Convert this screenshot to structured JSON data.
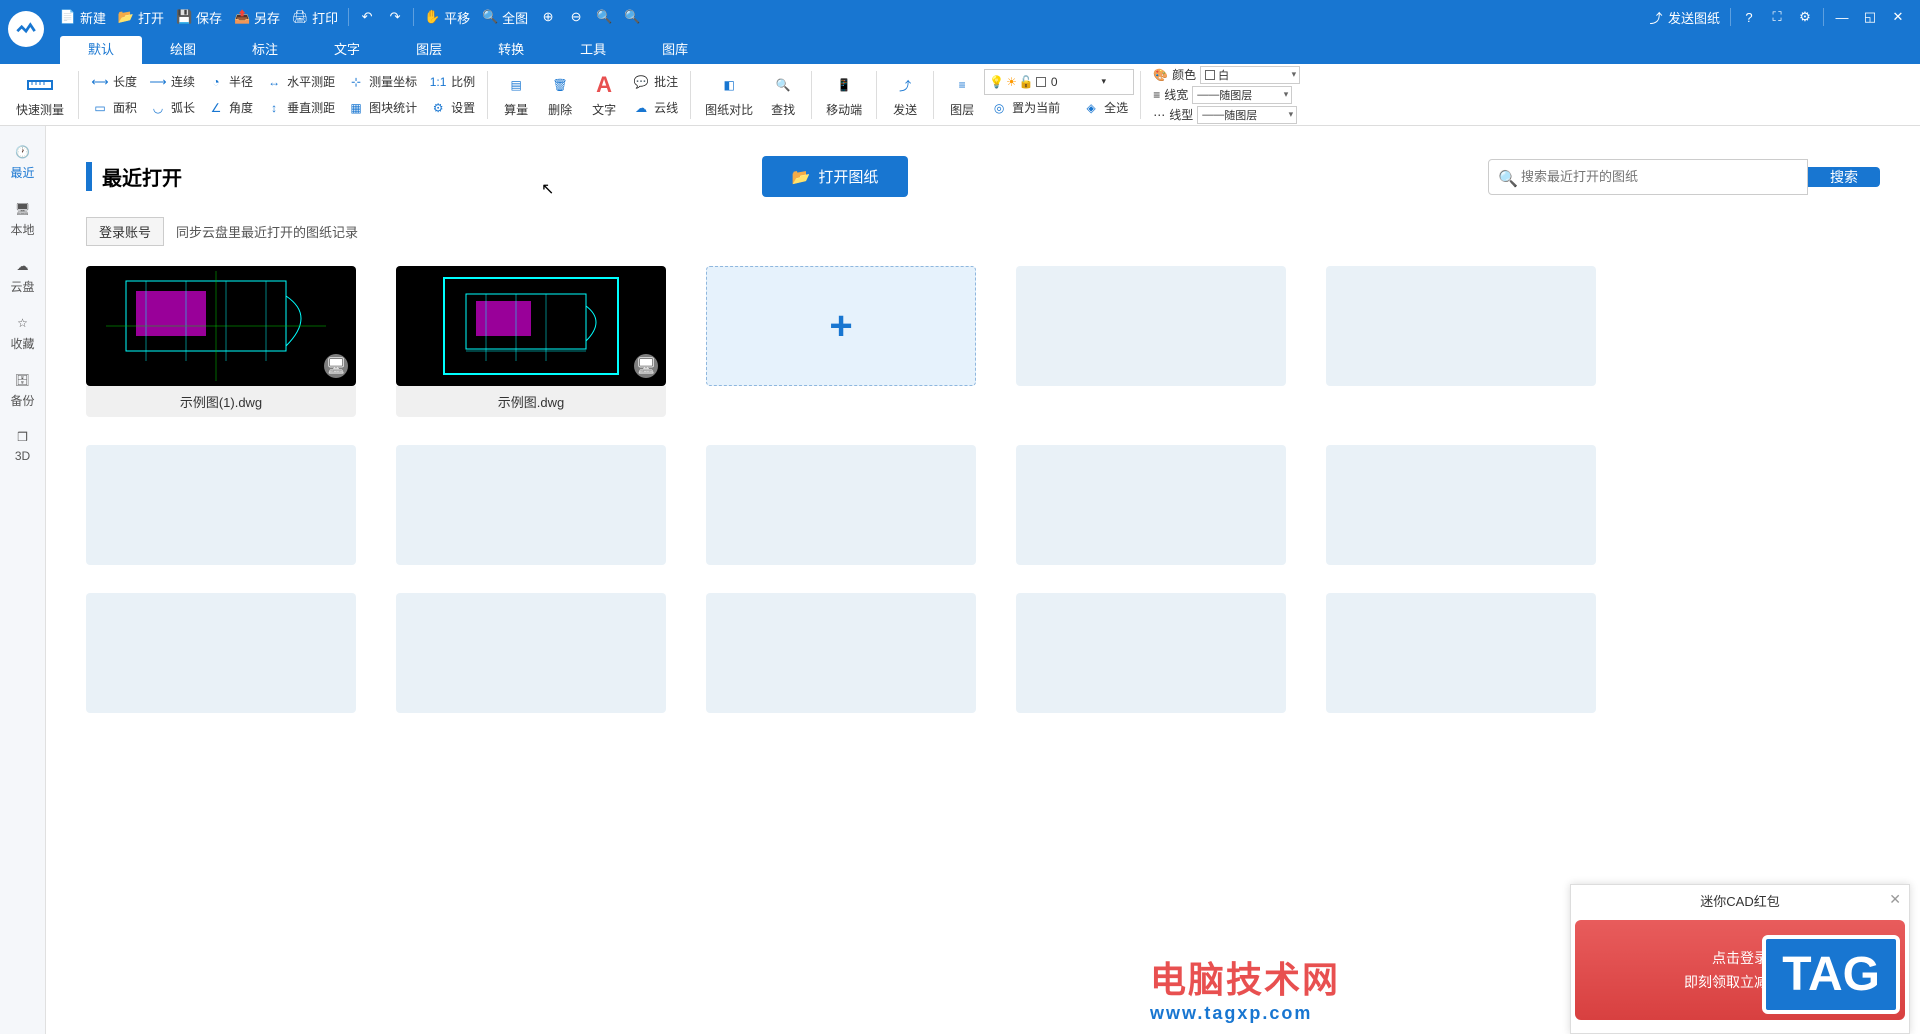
{
  "titlebar": {
    "new": "新建",
    "open": "打开",
    "save": "保存",
    "saveas": "另存",
    "print": "打印",
    "pan": "平移",
    "full": "全图",
    "send": "发送图纸"
  },
  "tabs": [
    "默认",
    "绘图",
    "标注",
    "文字",
    "图层",
    "转换",
    "工具",
    "图库"
  ],
  "ribbon": {
    "quick_measure": "快速测量",
    "length": "长度",
    "continuous": "连续",
    "radius": "半径",
    "horiz": "水平测距",
    "area": "面积",
    "arc": "弧长",
    "angle": "角度",
    "vert": "垂直测距",
    "coord": "测量坐标",
    "block_stat": "图块统计",
    "scale": "比例",
    "settings": "设置",
    "calc": "算量",
    "delete": "删除",
    "text": "文字",
    "annotate": "批注",
    "cloud": "云线",
    "compare": "图纸对比",
    "find": "查找",
    "mobile": "移动端",
    "send": "发送",
    "layer": "图层",
    "set_current": "置为当前",
    "select_all": "全选",
    "color_label": "颜色",
    "color_value": "白",
    "linewidth_label": "线宽",
    "linewidth_value": "随图层",
    "linetype_label": "线型",
    "linetype_value": "随图层",
    "layer_num": "0"
  },
  "sidebar": {
    "recent": "最近",
    "local": "本地",
    "cloud": "云盘",
    "favorite": "收藏",
    "backup": "备份",
    "three_d": "3D"
  },
  "content": {
    "title": "最近打开",
    "open_drawing": "打开图纸",
    "search_placeholder": "搜索最近打开的图纸",
    "search_btn": "搜索",
    "login": "登录账号",
    "sync_text": "同步云盘里最近打开的图纸记录",
    "files": [
      "示例图(1).dwg",
      "示例图.dwg"
    ]
  },
  "popup": {
    "title": "迷你CAD红包",
    "line1": "点击登录",
    "line2": "即刻领取立减红包"
  },
  "watermark": {
    "main": "电脑技术网",
    "sub": "www.tagxp.com",
    "tag": "TAG"
  }
}
